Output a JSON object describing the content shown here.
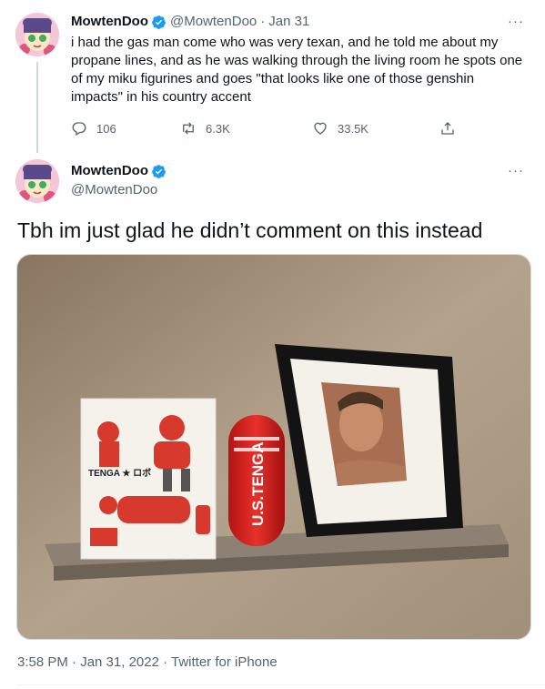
{
  "colors": {
    "verified": "#1d9bf0",
    "muted": "#536471",
    "text": "#0f1419"
  },
  "tweet1": {
    "display_name": "MowtenDoo",
    "handle": "@MowtenDoo",
    "separator": "·",
    "date": "Jan 31",
    "more": "···",
    "text": "i had the gas man come who was very texan, and he told me about my propane lines, and as he was walking through the living room he spots one of my miku figurines and goes \"that looks like one of those genshin impacts\" in his country accent",
    "replies": "106",
    "retweets": "6.3K",
    "likes": "33.5K"
  },
  "tweet2": {
    "display_name": "MowtenDoo",
    "handle": "@MowtenDoo",
    "more": "···",
    "text": "Tbh im just glad he didn’t comment on this instead",
    "photo": {
      "box_brand": "TENGA ★ ロボ",
      "cup_label": "U.S.TENGA"
    },
    "timestamp": "3:58 PM · Jan 31, 2022 · Twitter for iPhone"
  }
}
